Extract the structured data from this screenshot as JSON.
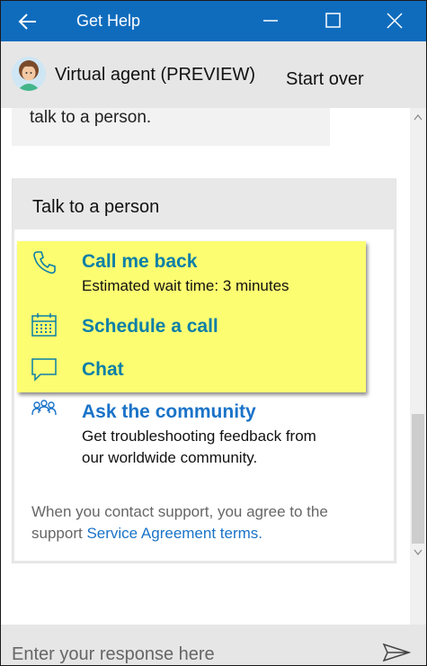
{
  "window": {
    "title": "Get Help",
    "titlebar_color": "#0f6cbd"
  },
  "header": {
    "agent_name": "Virtual agent (PREVIEW)",
    "start_over_label": "Start over"
  },
  "chat": {
    "previous_message": "talk to a person."
  },
  "card": {
    "title": "Talk to a person",
    "options": [
      {
        "icon": "phone-icon",
        "label": "Call me back",
        "sublabel": "Estimated wait time: 3 minutes"
      },
      {
        "icon": "calendar-icon",
        "label": "Schedule a call"
      },
      {
        "icon": "chat-icon",
        "label": "Chat"
      },
      {
        "icon": "community-icon",
        "label": "Ask the community",
        "sublabel_line1": "Get troubleshooting feedback from",
        "sublabel_line2": "our worldwide community."
      }
    ],
    "footer_prefix": "When you contact support, you agree to the support ",
    "footer_link": "Service Agreement terms."
  },
  "input": {
    "placeholder": "Enter your response here"
  },
  "colors": {
    "highlight": "#fdfd72",
    "option_text": "#0b7fa8",
    "link": "#1a73c8"
  }
}
